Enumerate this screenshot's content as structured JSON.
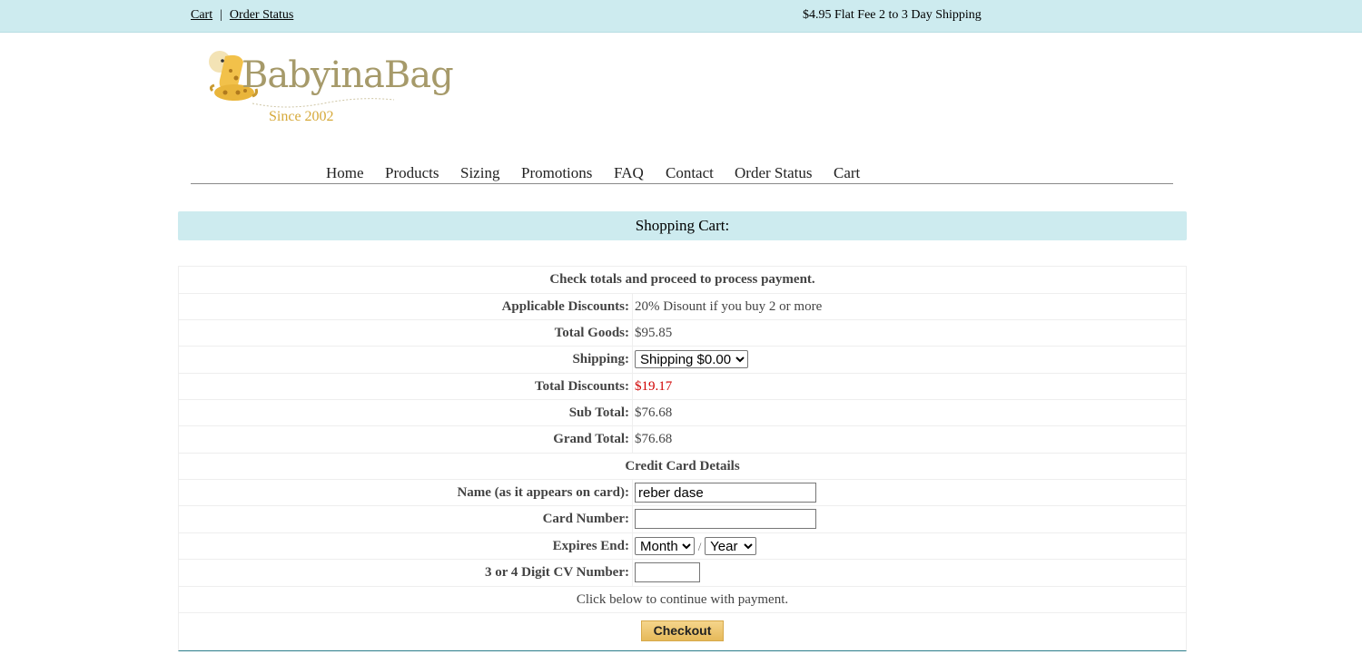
{
  "topbar": {
    "links": [
      "Cart",
      "Order Status"
    ],
    "separator": "|",
    "promo": "$4.95 Flat Fee 2 to 3 Day Shipping"
  },
  "logo": {
    "wordmark": "BabyinaBag",
    "tagline": "Since 2002",
    "icon": "giraffe-icon",
    "accent": "#d6a93a"
  },
  "nav": {
    "items": [
      "Home",
      "Products",
      "Sizing",
      "Promotions",
      "FAQ",
      "Contact",
      "Order Status",
      "Cart"
    ]
  },
  "section_title": "Shopping Cart:",
  "cart": {
    "intro": "Check totals and proceed to process payment.",
    "discount_label": "Applicable Discounts:",
    "discount_value": "20% Disount if you buy 2 or more",
    "goods_label": "Total Goods:",
    "goods_value": "$95.85",
    "shipping_label": "Shipping:",
    "shipping_selected": "Shipping $0.00",
    "total_discount_label": "Total Discounts:",
    "total_discount_value": "$19.17",
    "subtotal_label": "Sub Total:",
    "subtotal_value": "$76.68",
    "grand_label": "Grand Total:",
    "grand_value": "$76.68"
  },
  "card": {
    "heading": "Credit Card Details",
    "name_label": "Name (as it appears on card):",
    "name_value": "reber dase",
    "number_label": "Card Number:",
    "number_value": "",
    "expires_label": "Expires End:",
    "month_selected": "Month",
    "year_selected": "Year",
    "date_separator": "/",
    "cvv_label": "3 or 4 Digit CV Number:",
    "cvv_value": ""
  },
  "footer": {
    "prompt": "Click below to continue with payment.",
    "checkout_label": "Checkout"
  },
  "colors": {
    "bar_bg": "#cdebef",
    "discount_red": "#d00000",
    "button_gold": "#e6b95a"
  }
}
